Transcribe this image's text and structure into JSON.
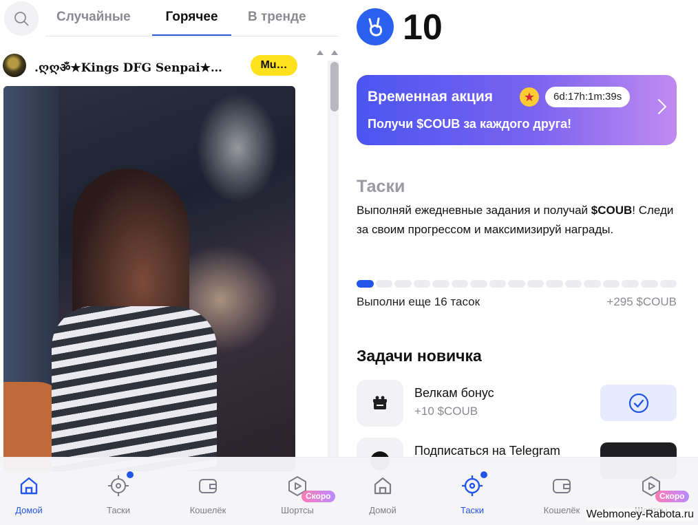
{
  "left": {
    "tabs": [
      "Случайные",
      "Горячее",
      "В тренде"
    ],
    "active_tab": "Горячее",
    "post": {
      "author": ".ღღॐ★Kings  DFG Senpai★…",
      "badge": "Mu…"
    }
  },
  "nav_left": {
    "items": [
      {
        "label": "Домой",
        "icon": "home-icon",
        "active": true
      },
      {
        "label": "Таски",
        "icon": "target-icon",
        "dot": true
      },
      {
        "label": "Кошелёк",
        "icon": "wallet-icon"
      },
      {
        "label": "Шортсы",
        "icon": "play-icon",
        "soon": "Скоро"
      }
    ]
  },
  "right": {
    "balance": "10",
    "promo": {
      "title": "Временная акция",
      "emoji": "star-eyes-emoji",
      "timer": "6d:17h:1m:39s",
      "subtitle": "Получи $COUB за каждого друга!"
    },
    "tasks": {
      "title": "Таски",
      "desc_before": "Выполняй ежедневные задания и получай ",
      "desc_bold": "$COUB",
      "desc_after": "! Следи за своим прогрессом и максимизируй награды.",
      "progress_done": 1,
      "progress_total": 17,
      "remaining": "Выполни еще 16 тасок",
      "reward": "+295 $COUB"
    },
    "newbie": {
      "title": "Задачи новичка",
      "items": [
        {
          "name": "Велкам бонус",
          "reward": "+10 $COUB",
          "status": "done"
        },
        {
          "name": "Подписаться на Telegram",
          "reward": "",
          "status": "todo"
        }
      ]
    }
  },
  "nav_right": {
    "items": [
      {
        "label": "Домой",
        "icon": "home-icon"
      },
      {
        "label": "Таски",
        "icon": "target-icon",
        "active": true,
        "dot": true
      },
      {
        "label": "Кошелёк",
        "icon": "wallet-icon"
      },
      {
        "label": "Шортсы",
        "icon": "play-icon",
        "soon": "Скоро"
      }
    ]
  },
  "watermark": "Webmoney-Rabota.ru",
  "colors": {
    "accent": "#2255e8",
    "badge": "#ffe11d",
    "promo_start": "#4b55f0",
    "promo_end": "#c08af0"
  }
}
